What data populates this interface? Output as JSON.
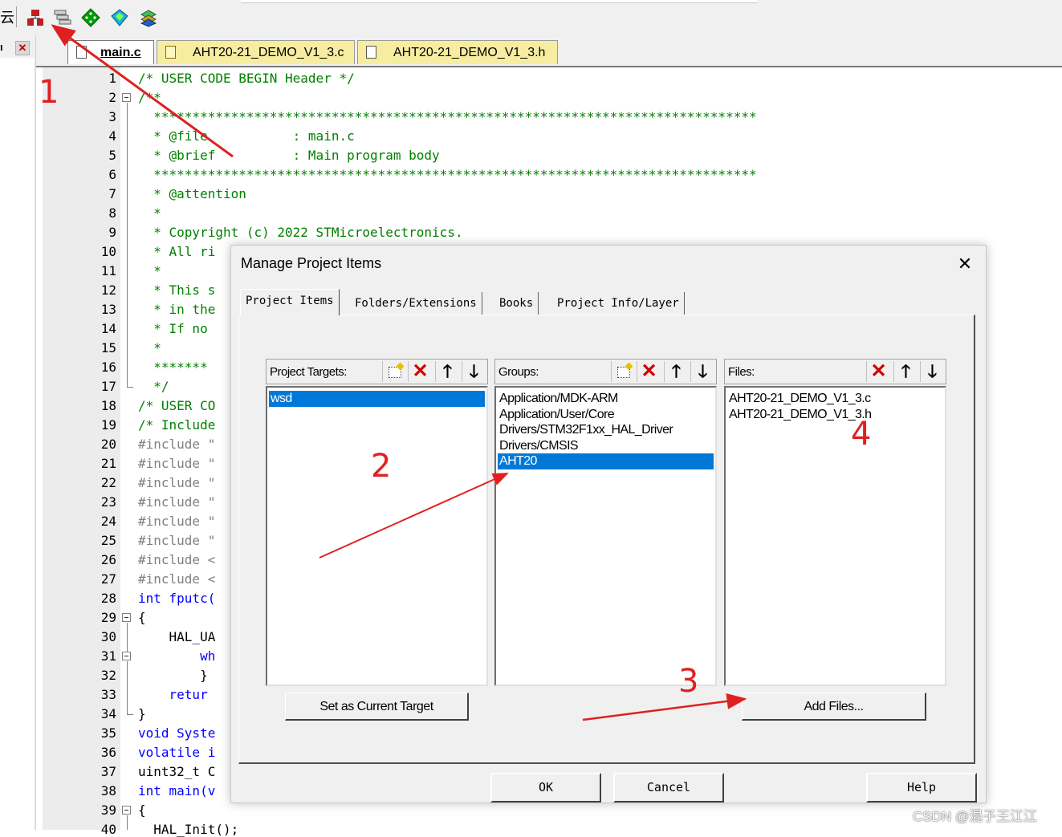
{
  "toolbar": {
    "buttons": [
      {
        "name": "manage-project-items-icon",
        "color": "#c02020"
      },
      {
        "name": "select-packs-icon",
        "color": "#607080"
      },
      {
        "name": "green-diamond-icon",
        "color": "#00a000"
      },
      {
        "name": "pack-installer-icon",
        "color": "#00a0c0"
      },
      {
        "name": "layers-icon",
        "color": "#00a040"
      }
    ],
    "left_char": "云"
  },
  "editor": {
    "tabs": [
      {
        "label": "main.c",
        "active": true
      },
      {
        "label": "AHT20-21_DEMO_V1_3.c",
        "active": false
      },
      {
        "label": "AHT20-21_DEMO_V1_3.h",
        "active": false
      }
    ],
    "lines": [
      {
        "n": "1",
        "text": "/* USER CODE BEGIN Header */",
        "cls": "cm"
      },
      {
        "n": "2",
        "text": "/**",
        "cls": "cm"
      },
      {
        "n": "3",
        "text": "  ******************************************************************************",
        "cls": "cm"
      },
      {
        "n": "4",
        "text": "  * @file           : main.c",
        "cls": "cm"
      },
      {
        "n": "5",
        "text": "  * @brief          : Main program body",
        "cls": "cm"
      },
      {
        "n": "6",
        "text": "  ******************************************************************************",
        "cls": "cm"
      },
      {
        "n": "7",
        "text": "  * @attention",
        "cls": "cm"
      },
      {
        "n": "8",
        "text": "  *",
        "cls": "cm"
      },
      {
        "n": "9",
        "text": "  * Copyright (c) 2022 STMicroelectronics.",
        "cls": "cm"
      },
      {
        "n": "10",
        "text": "  * All ri",
        "cls": "cm"
      },
      {
        "n": "11",
        "text": "  *",
        "cls": "cm"
      },
      {
        "n": "12",
        "text": "  * This s",
        "cls": "cm"
      },
      {
        "n": "13",
        "text": "  * in the",
        "cls": "cm"
      },
      {
        "n": "14",
        "text": "  * If no",
        "cls": "cm"
      },
      {
        "n": "15",
        "text": "  *",
        "cls": "cm"
      },
      {
        "n": "16",
        "text": "  *******",
        "cls": "cm"
      },
      {
        "n": "17",
        "text": "  */",
        "cls": "cm"
      },
      {
        "n": "18",
        "text": "/* USER CO",
        "cls": "cm"
      },
      {
        "n": "19",
        "text": "/* Include",
        "cls": "cm"
      },
      {
        "n": "20",
        "text": "#include \"",
        "cls": "pp"
      },
      {
        "n": "21",
        "text": "#include \"",
        "cls": "pp"
      },
      {
        "n": "22",
        "text": "#include \"",
        "cls": "pp"
      },
      {
        "n": "23",
        "text": "#include \"",
        "cls": "pp"
      },
      {
        "n": "24",
        "text": "#include \"",
        "cls": "pp"
      },
      {
        "n": "25",
        "text": "#include \"",
        "cls": "pp"
      },
      {
        "n": "26",
        "text": "#include <",
        "cls": "pp"
      },
      {
        "n": "27",
        "text": "#include <",
        "cls": "pp"
      },
      {
        "n": "28",
        "text": "int fputc(",
        "cls": "kw"
      },
      {
        "n": "29",
        "text": "{",
        "cls": ""
      },
      {
        "n": "30",
        "text": "    HAL_UA",
        "cls": ""
      },
      {
        "n": "31",
        "text": "        wh",
        "cls": "kw"
      },
      {
        "n": "32",
        "text": "        }",
        "cls": ""
      },
      {
        "n": "33",
        "text": "    retur",
        "cls": "kw"
      },
      {
        "n": "34",
        "text": "}",
        "cls": ""
      },
      {
        "n": "35",
        "text": "void Syste",
        "cls": "kw"
      },
      {
        "n": "36",
        "text": "volatile i",
        "cls": "kw"
      },
      {
        "n": "37",
        "text": "uint32_t C",
        "cls": ""
      },
      {
        "n": "38",
        "text": "int main(v",
        "cls": "kw"
      },
      {
        "n": "39",
        "text": "{",
        "cls": ""
      },
      {
        "n": "40",
        "text": "  HAL_Init();",
        "cls": ""
      }
    ]
  },
  "dialog": {
    "title": "Manage Project Items",
    "close_glyph": "✕",
    "tabs": [
      "Project Items",
      "Folders/Extensions",
      "Books",
      "Project Info/Layer"
    ],
    "targets": {
      "label": "Project Targets:",
      "items": [
        "wsd"
      ],
      "selected": "wsd",
      "set_current_label": "Set as Current Target"
    },
    "groups": {
      "label": "Groups:",
      "items": [
        "Application/MDK-ARM",
        "Application/User/Core",
        "Drivers/STM32F1xx_HAL_Driver",
        "Drivers/CMSIS",
        "AHT20"
      ],
      "selected": "AHT20"
    },
    "files": {
      "label": "Files:",
      "items": [
        "AHT20-21_DEMO_V1_3.c",
        "AHT20-21_DEMO_V1_3.h"
      ],
      "add_files_label": "Add Files..."
    },
    "ok_label": "OK",
    "cancel_label": "Cancel",
    "help_label": "Help"
  },
  "annotations": {
    "labels": [
      "1",
      "2",
      "3",
      "4"
    ],
    "color": "#e02020"
  },
  "watermark": "CSDN @混子王江江",
  "colors": {
    "selection": "#0078d7",
    "comment": "#008000",
    "keyword": "#0000ff",
    "preprocessor": "#808080"
  }
}
